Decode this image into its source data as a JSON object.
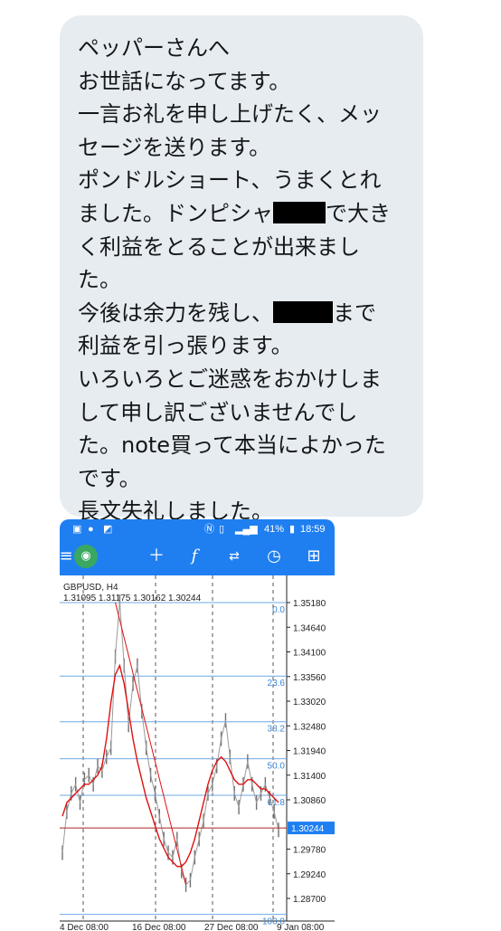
{
  "message": {
    "lines": [
      {
        "text": "ペッパーさんへ"
      },
      {
        "text": "お世話になってます。"
      },
      {
        "text": "一言お礼を申し上げたく、メッ"
      },
      {
        "text": "セージを送ります。"
      },
      {
        "text": "ポンドルショート、うまくとれ"
      },
      {
        "pre": "ました。ドンピシャ",
        "post": "で大き"
      },
      {
        "text": "く利益をとることが出来まし"
      },
      {
        "text": "た。"
      },
      {
        "pre": "今後は余力を残し、",
        "post": "まで"
      },
      {
        "text": "利益を引っ張ります。"
      },
      {
        "text": "いろいろとご迷惑をおかけしま"
      },
      {
        "text": "して申し訳ございませんでし"
      },
      {
        "text": "た。note買って本当によかった"
      },
      {
        "text": "です。"
      },
      {
        "text": "長文失礼しました。"
      }
    ]
  },
  "status_bar": {
    "battery": "41%",
    "time": "18:59"
  },
  "toolbar": {
    "icons": [
      "menu-icon",
      "crosshair-icon",
      "function-icon",
      "trade-icon",
      "clock-icon",
      "new-order-icon"
    ]
  },
  "chart_header": {
    "symbol": "GBPUSD, H4",
    "ohlc": "1.31095 1.31175 1.30162 1.30244"
  },
  "chart_data": {
    "type": "line",
    "title": "GBPUSD, H4",
    "price_labels": [
      "1.35180",
      "1.34640",
      "1.34100",
      "1.33560",
      "1.33020",
      "1.32480",
      "1.31940",
      "1.31400",
      "1.30860",
      "1.29780",
      "1.29240",
      "1.28700"
    ],
    "current_price": "1.30244",
    "fibonacci_levels": [
      {
        "label": "0.0",
        "price": 1.3518
      },
      {
        "label": "23.6",
        "price": 1.3357
      },
      {
        "label": "38.2",
        "price": 1.3257
      },
      {
        "label": "50.0",
        "price": 1.3176
      },
      {
        "label": "61.8",
        "price": 1.3096
      },
      {
        "label": "100.0",
        "price": 1.2835
      }
    ],
    "x_labels": [
      "4 Dec 08:00",
      "16 Dec 08:00",
      "27 Dec 08:00",
      "9 Jan 08:00"
    ],
    "price_series": [
      1.297,
      1.306,
      1.31,
      1.312,
      1.308,
      1.313,
      1.314,
      1.312,
      1.316,
      1.315,
      1.318,
      1.32,
      1.34,
      1.352,
      1.338,
      1.325,
      1.334,
      1.338,
      1.328,
      1.32,
      1.314,
      1.31,
      1.305,
      1.3,
      1.297,
      1.296,
      1.3,
      1.293,
      1.29,
      1.291,
      1.296,
      1.3,
      1.304,
      1.31,
      1.312,
      1.316,
      1.322,
      1.326,
      1.318,
      1.31,
      1.307,
      1.312,
      1.317,
      1.312,
      1.308,
      1.31,
      1.312,
      1.309,
      1.306,
      1.302
    ],
    "ma_series": [
      1.305,
      1.308,
      1.309,
      1.31,
      1.311,
      1.312,
      1.312,
      1.313,
      1.314,
      1.316,
      1.322,
      1.33,
      1.336,
      1.338,
      1.334,
      1.328,
      1.322,
      1.317,
      1.313,
      1.309,
      1.306,
      1.303,
      1.3,
      1.298,
      1.296,
      1.295,
      1.294,
      1.294,
      1.295,
      1.297,
      1.3,
      1.304,
      1.308,
      1.312,
      1.315,
      1.317,
      1.318,
      1.317,
      1.315,
      1.313,
      1.312,
      1.312,
      1.313,
      1.313,
      1.312,
      1.311,
      1.311,
      1.31,
      1.309,
      1.308
    ],
    "colors": {
      "fib": "#6fa8e6",
      "price": "#707070",
      "ma": "#e11010",
      "current_price_bg": "#1f7ff0"
    }
  }
}
